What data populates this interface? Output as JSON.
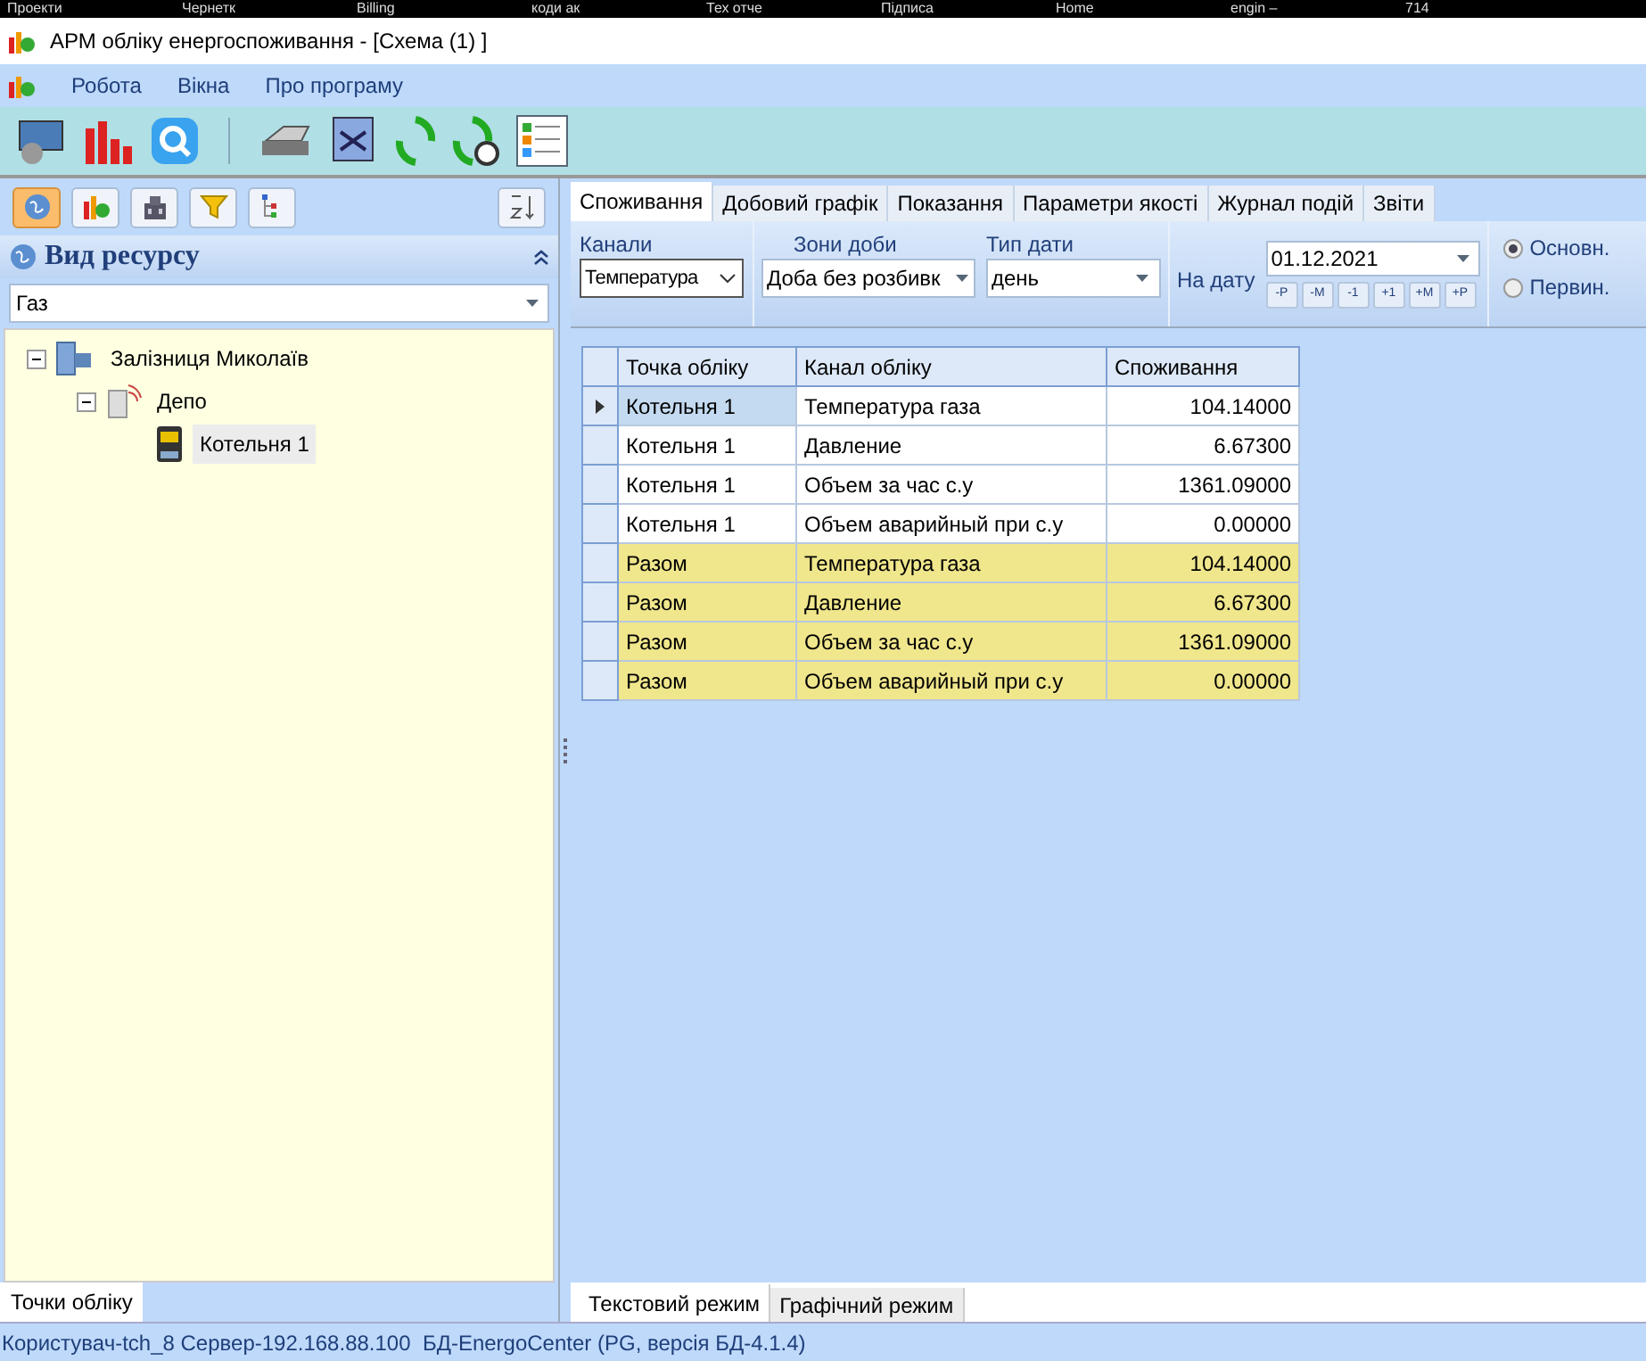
{
  "browser_tabs": [
    {
      "label": "Проекти"
    },
    {
      "label": "Чернетк"
    },
    {
      "label": "Billing"
    },
    {
      "label": "коди ак"
    },
    {
      "label": "Тех отче"
    },
    {
      "label": "Підписа"
    },
    {
      "label": "Home"
    },
    {
      "label": "engin –"
    },
    {
      "label": "714"
    }
  ],
  "window": {
    "title": "АРМ обліку енергоспоживання - [Схема (1) ]"
  },
  "menu": [
    "Робота",
    "Вікна",
    "Про програму"
  ],
  "left_panel": {
    "tool_buttons": [
      {
        "kind": "globe",
        "selected": true
      },
      {
        "kind": "chart",
        "selected": false
      },
      {
        "kind": "building",
        "selected": false
      },
      {
        "kind": "filter",
        "selected": false
      },
      {
        "kind": "tree",
        "selected": false
      }
    ],
    "header": "Вид ресурсу",
    "resource": "Газ",
    "tree": [
      {
        "label": "Залізниця Миколаїв",
        "kind": "server",
        "expanded": true,
        "selected": false,
        "children": [
          {
            "label": "Депо",
            "kind": "building",
            "expanded": true,
            "selected": false,
            "children": [
              {
                "label": "Котельня 1",
                "kind": "meter",
                "selected": true
              }
            ]
          }
        ]
      }
    ],
    "bottom_tab": "Точки обліку"
  },
  "tabs": [
    {
      "label": "Споживання",
      "selected": true
    },
    {
      "label": "Добовий графік",
      "selected": false
    },
    {
      "label": "Показання",
      "selected": false
    },
    {
      "label": "Параметри якості",
      "selected": false
    },
    {
      "label": "Журнал подій",
      "selected": false
    },
    {
      "label": "Звіти",
      "selected": false
    }
  ],
  "filters": {
    "channels_label": "Канали",
    "channels_value": "Температура",
    "zones_label": "Зони доби",
    "zones_value": "Доба без розбивк",
    "date_type_label": "Тип дати",
    "date_type_value": "день",
    "date_label": "На дату",
    "date_value": "01.12.2021",
    "date_buttons": [
      "-Р",
      "-М",
      "-1",
      "+1",
      "+М",
      "+Р"
    ],
    "modes": [
      {
        "label": "Основн.",
        "selected": true
      },
      {
        "label": "Первин.",
        "selected": false
      }
    ]
  },
  "table": {
    "columns": [
      "Точка обліку",
      "Канал обліку",
      "Споживання"
    ],
    "rows": [
      {
        "kind": "item",
        "current": true,
        "cells": [
          "Котельня 1",
          "Температура газа",
          "104.14000"
        ]
      },
      {
        "kind": "item",
        "current": false,
        "cells": [
          "Котельня 1",
          "Давление",
          "6.67300"
        ]
      },
      {
        "kind": "item",
        "current": false,
        "cells": [
          "Котельня 1",
          "Объем за час с.у",
          "1361.09000"
        ]
      },
      {
        "kind": "item",
        "current": false,
        "cells": [
          "Котельня 1",
          "Объем аварийный при с.у",
          "0.00000"
        ]
      },
      {
        "kind": "total",
        "current": false,
        "cells": [
          "Разом",
          "Температура газа",
          "104.14000"
        ]
      },
      {
        "kind": "total",
        "current": false,
        "cells": [
          "Разом",
          "Давление",
          "6.67300"
        ]
      },
      {
        "kind": "total",
        "current": false,
        "cells": [
          "Разом",
          "Объем за час с.у",
          "1361.09000"
        ]
      },
      {
        "kind": "total",
        "current": false,
        "cells": [
          "Разом",
          "Объем аварийный при с.у",
          "0.00000"
        ]
      }
    ]
  },
  "view_tabs": [
    {
      "label": "Текстовий режим",
      "selected": true
    },
    {
      "label": "Графічний режим",
      "selected": false
    }
  ],
  "status_bar": "Користувач-tch_8 Сервер-192.168.88.100  БД-EnergoCenter (PG, версія БД-4.1.4)"
}
